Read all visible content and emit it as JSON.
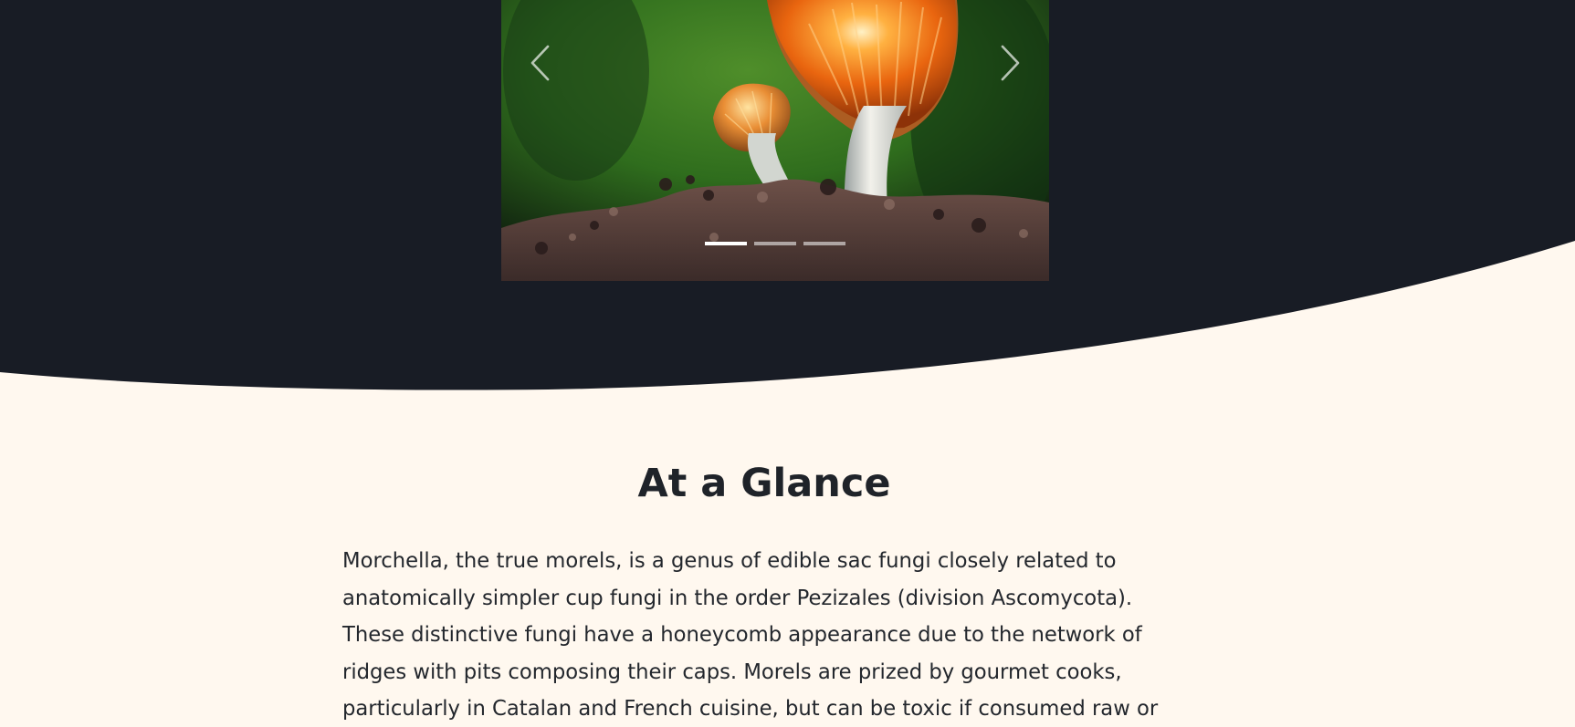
{
  "carousel": {
    "image_subject": "orange mushrooms growing from soil against a green background",
    "previous_icon": "chevron-left-icon",
    "next_icon": "chevron-right-icon",
    "slide_indicators": [
      {
        "active": true
      },
      {
        "active": false
      },
      {
        "active": false
      }
    ]
  },
  "glance": {
    "title": "At a Glance",
    "paragraph": "Morchella, the true morels, is a genus of edible sac fungi closely related to anatomically simpler cup fungi in the order Pezizales (division Ascomycota). These distinctive fungi have a honeycomb appearance due to the network of ridges with pits composing their caps. Morels are prized by gourmet cooks, particularly in Catalan and French cuisine, but can be toxic if consumed raw or"
  },
  "colors": {
    "hero_dark": "#181c25",
    "page_background": "#fff8ef",
    "heading": "#1f2329",
    "body_text": "#23272d"
  }
}
